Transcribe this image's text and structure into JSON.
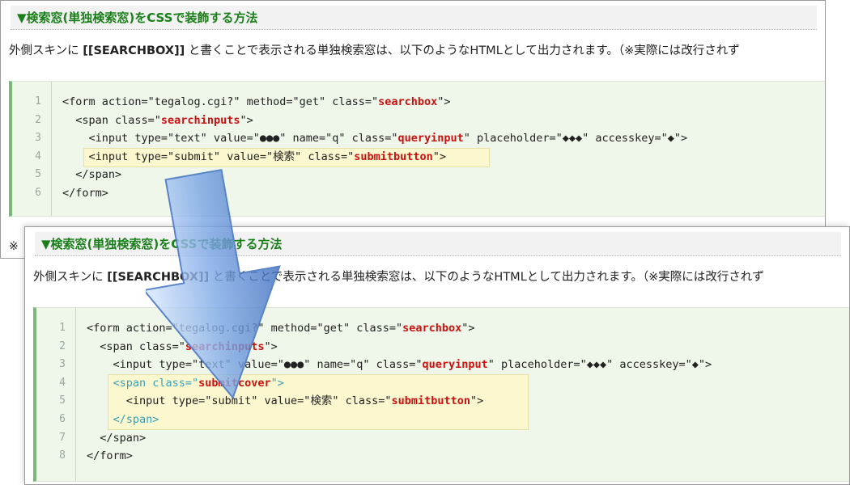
{
  "top": {
    "heading": "▼検索窓(単独検索窓)をCSSで装飾する方法",
    "intro_before": "外側スキンに ",
    "intro_tag": "[[SEARCHBOX]]",
    "intro_after": " と書くことで表示される単独検索窓は、以下のようなHTMLとして出力されます。（※実際には改行されず",
    "note": "※",
    "lines": [
      {
        "n": "1",
        "parts": [
          {
            "t": "<form action=\"tegalog.cgi?\" method=\"get\" class=\""
          },
          {
            "t": "searchbox",
            "c": "hl"
          },
          {
            "t": "\">"
          }
        ]
      },
      {
        "n": "2",
        "parts": [
          {
            "t": "  <span class=\""
          },
          {
            "t": "searchinputs",
            "c": "hl"
          },
          {
            "t": "\">"
          }
        ]
      },
      {
        "n": "3",
        "parts": [
          {
            "t": "    <input type=\"text\" value=\"●●●\" name=\"q\" class=\""
          },
          {
            "t": "queryinput",
            "c": "hl"
          },
          {
            "t": "\" placeholder=\"◆◆◆\" accesskey=\"◆\">"
          }
        ]
      },
      {
        "n": "4",
        "parts": [
          {
            "t": "    <input type=\"submit\" value=\"検索\" class=\""
          },
          {
            "t": "submitbutton",
            "c": "hl"
          },
          {
            "t": "\">"
          }
        ]
      },
      {
        "n": "5",
        "parts": [
          {
            "t": "  </span>"
          }
        ]
      },
      {
        "n": "6",
        "parts": [
          {
            "t": "</form>"
          }
        ]
      }
    ]
  },
  "bottom": {
    "heading": "▼検索窓(単独検索窓)をCSSで装飾する方法",
    "intro_before": "外側スキンに ",
    "intro_tag": "[[SEARCHBOX]]",
    "intro_after": " と書くことで表示される単独検索窓は、以下のようなHTMLとして出力されます。（※実際には改行されず",
    "lines": [
      {
        "n": "1",
        "parts": [
          {
            "t": "<form action=\"tegalog.cgi?\" method=\"get\" class=\""
          },
          {
            "t": "searchbox",
            "c": "hl"
          },
          {
            "t": "\">"
          }
        ]
      },
      {
        "n": "2",
        "parts": [
          {
            "t": "  <span class=\""
          },
          {
            "t": "searchinputs",
            "c": "hl"
          },
          {
            "t": "\">"
          }
        ]
      },
      {
        "n": "3",
        "parts": [
          {
            "t": "    <input type=\"text\" value=\"●●●\" name=\"q\" class=\""
          },
          {
            "t": "queryinput",
            "c": "hl"
          },
          {
            "t": "\" placeholder=\"◆◆◆\" accesskey=\"◆\">"
          }
        ]
      },
      {
        "n": "4",
        "parts": [
          {
            "t": "    <span class=\"",
            "c": "added"
          },
          {
            "t": "submitcover",
            "c": "hl"
          },
          {
            "t": "\">",
            "c": "added"
          }
        ]
      },
      {
        "n": "5",
        "parts": [
          {
            "t": "      <input type=\"submit\" value=\"検索\" class=\""
          },
          {
            "t": "submitbutton",
            "c": "hl"
          },
          {
            "t": "\">"
          }
        ]
      },
      {
        "n": "6",
        "parts": [
          {
            "t": "    </span>",
            "c": "added"
          }
        ]
      },
      {
        "n": "7",
        "parts": [
          {
            "t": "  </span>"
          }
        ]
      },
      {
        "n": "8",
        "parts": [
          {
            "t": "</form>"
          }
        ]
      }
    ]
  },
  "colors": {
    "heading_text": "#1a7f1a",
    "highlight_class": "#cc1111",
    "added_markup": "#3aa0b8",
    "code_background": "#eef7ea",
    "highlight_box": "#fbf7cf",
    "arrow": "#5b8fd6"
  },
  "icons": {
    "arrow": "arrow-down-icon"
  }
}
